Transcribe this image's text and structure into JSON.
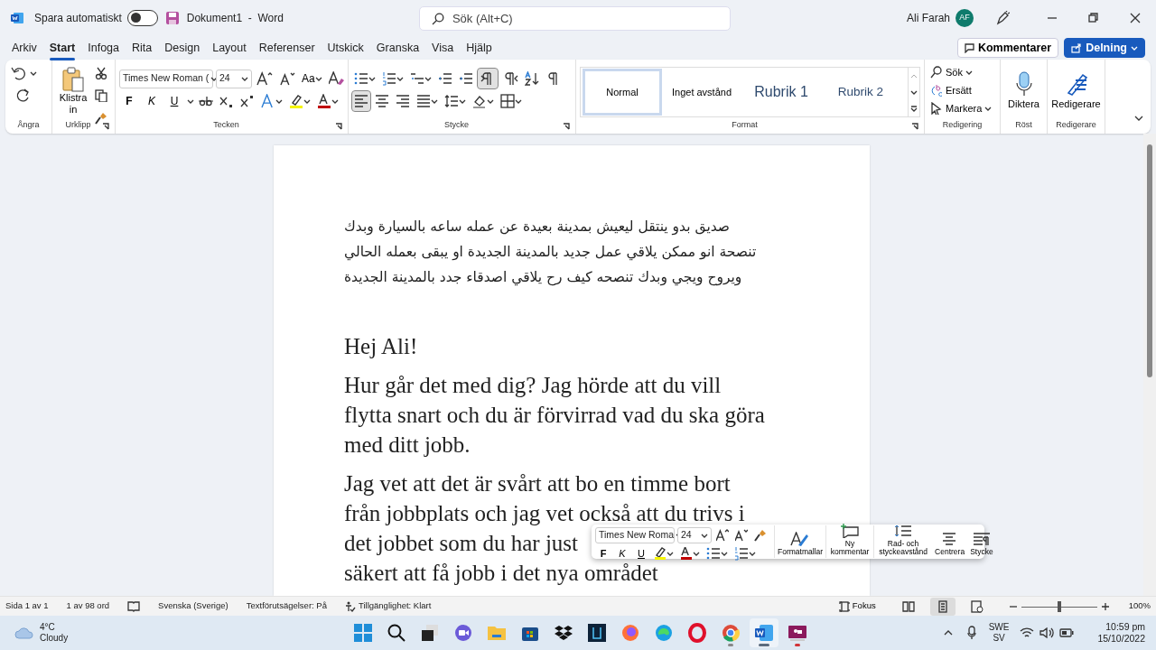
{
  "title_bar": {
    "autosave_label": "Spara automatiskt",
    "autosave_on": false,
    "document_title": "Dokument1  -  Word",
    "search": {
      "placeholder": "Sök (Alt+C)"
    },
    "user_name": "Ali Farah",
    "avatar_initials": "AF"
  },
  "ribbon_tabs": [
    {
      "label": "Arkiv",
      "selected": false
    },
    {
      "label": "Start",
      "selected": true
    },
    {
      "label": "Infoga",
      "selected": false
    },
    {
      "label": "Rita",
      "selected": false
    },
    {
      "label": "Design",
      "selected": false
    },
    {
      "label": "Layout",
      "selected": false
    },
    {
      "label": "Referenser",
      "selected": false
    },
    {
      "label": "Utskick",
      "selected": false
    },
    {
      "label": "Granska",
      "selected": false
    },
    {
      "label": "Visa",
      "selected": false
    },
    {
      "label": "Hjälp",
      "selected": false
    }
  ],
  "header_buttons": {
    "comments": "Kommentarer",
    "share": "Delning"
  },
  "ribbon_groups": [
    {
      "kind": "undo",
      "label": "Ångra"
    },
    {
      "kind": "clipboard",
      "label": "Urklipp",
      "paste_label": "Klistra in"
    },
    {
      "kind": "font",
      "label": "Tecken",
      "font": "Times New Roman (",
      "size": "24",
      "case_label": "Aa",
      "buttons": [
        "F",
        "K",
        "U"
      ]
    },
    {
      "kind": "paragraph",
      "label": "Stycke",
      "direction_buttons": [
        {
          "selected": true
        },
        {
          "selected": false
        }
      ],
      "alignment_buttons": [
        {
          "selected": true
        },
        {
          "selected": false
        },
        {
          "selected": false
        },
        {
          "selected": false
        }
      ]
    },
    {
      "kind": "styles",
      "label": "Format",
      "styles": [
        {
          "name": "Normal",
          "selected": true
        },
        {
          "name": "Inget avstånd",
          "selected": false
        },
        {
          "name": "Rubrik 1",
          "selected": false
        },
        {
          "name": "Rubrik 2",
          "selected": false
        }
      ]
    },
    {
      "kind": "editing",
      "label": "Redigering",
      "items": [
        "Sök",
        "Ersätt",
        "Markera"
      ]
    },
    {
      "kind": "voice",
      "label": "Röst",
      "button": "Diktera"
    },
    {
      "kind": "editor",
      "label": "Redigerare",
      "button": "Redigerare"
    }
  ],
  "document": {
    "rtl_lines": [
      "صديق بدو ينتقل ليعيش بمدينة بعيدة عن عمله ساعه بالسيارة وبدك",
      "تنصحة انو ممكن يلاقي عمل جديد بالمدينة الجديدة او يبقى بعمله الحالي",
      "ويروح ويجي وبدك تنصحه كيف رح يلاقي اصدقاء جدد بالمدينة الجديدة"
    ],
    "paragraphs": [
      {
        "lines": [
          "Hej Ali!"
        ]
      },
      {
        "lines": [
          "Hur går det med dig? Jag hörde att du vill",
          "flytta snart och du är förvirrad vad du ska göra",
          "med ditt jobb."
        ]
      },
      {
        "lines": [
          "Jag vet att det är svårt att bo en timme bort",
          "från jobbplats och jag vet också att du trivs i",
          "det jobbet som du har just",
          "säkert att få jobb i det nya området"
        ]
      }
    ]
  },
  "mini_toolbar": {
    "font": "Times New Roma",
    "size": "24",
    "buttons": [
      "F",
      "K",
      "U"
    ],
    "actions": [
      "Formatmallar",
      "Ny kommentar",
      "Rad- och styckeavstånd",
      "Centrera",
      "Stycke"
    ]
  },
  "status_bar": {
    "items": [
      "Sida 1 av 1",
      "1 av 98 ord",
      "Svenska (Sverige)",
      "Textförutsägelser: På",
      "Tillgänglighet: Klart"
    ],
    "focus": "Fokus",
    "views": [
      {
        "selected": false
      },
      {
        "selected": true
      },
      {
        "selected": false
      }
    ],
    "zoom": {
      "level": 0.5
    },
    "zoom_label": "100%"
  },
  "taskbar": {
    "weather": {
      "temp": "4°C",
      "condition": "Cloudy"
    },
    "apps": [
      {
        "kind": "start",
        "running": false,
        "selected": false
      },
      {
        "kind": "search",
        "running": false,
        "selected": false
      },
      {
        "kind": "taskview",
        "running": false,
        "selected": false
      },
      {
        "kind": "chat",
        "running": false,
        "selected": false
      },
      {
        "kind": "explorer",
        "running": false,
        "selected": false
      },
      {
        "kind": "store",
        "running": false,
        "selected": false
      },
      {
        "kind": "dropbox",
        "running": false,
        "selected": false
      },
      {
        "kind": "vpn",
        "running": false,
        "selected": false
      },
      {
        "kind": "firefox",
        "running": false,
        "selected": false
      },
      {
        "kind": "edge",
        "running": false,
        "selected": false
      },
      {
        "kind": "opera",
        "running": false,
        "selected": false
      },
      {
        "kind": "chrome",
        "running": true,
        "selected": false
      },
      {
        "kind": "word",
        "running": true,
        "selected": true
      },
      {
        "kind": "clipchamp",
        "running": true,
        "selected": false
      }
    ],
    "language": [
      "SWE",
      "SV"
    ],
    "time": "10:59 pm",
    "date": "15/10/2022"
  }
}
